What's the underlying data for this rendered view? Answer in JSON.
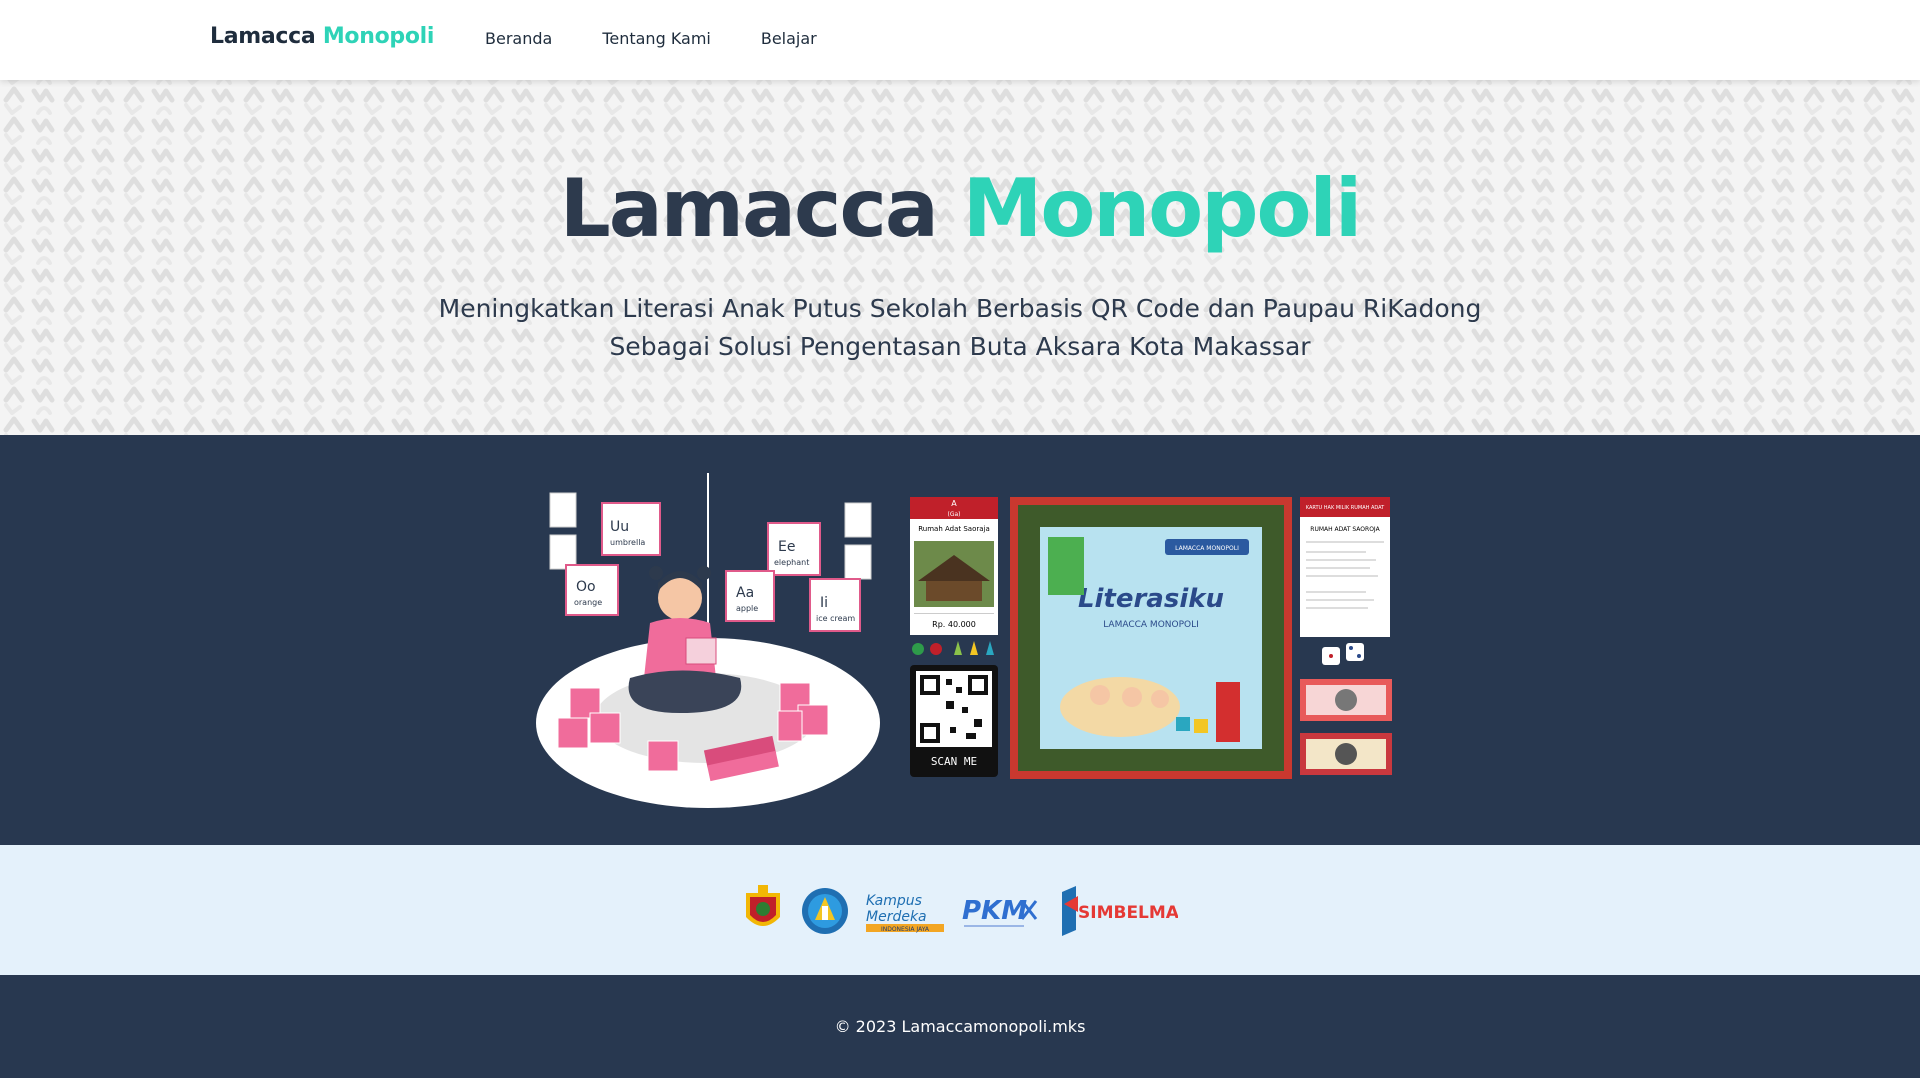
{
  "nav": {
    "brand_main": "Lamacca",
    "brand_accent": "Monopoli",
    "links": [
      "Beranda",
      "Tentang Kami",
      "Belajar"
    ]
  },
  "hero": {
    "title_main": "Lamacca",
    "title_accent": "Monopoli",
    "subtitle_line1": "Meningkatkan Literasi Anak Putus Sekolah Berbasis QR Code dan Paupau RiKadong",
    "subtitle_line2": "Sebagai Solusi Pengentasan Buta Aksara Kota Makassar"
  },
  "showcase": {
    "card_top": "A",
    "card_sub": "(Ga)",
    "card_title": "Rumah Adat Saoraja",
    "card_price": "Rp. 40.000",
    "qr_label": "SCAN ME",
    "board_banner": "LAMACCA MONOPOLI",
    "board_title": "Literasiku",
    "board_subtitle": "LAMACCA MONOPOLI",
    "deed_title": "KARTU HAK MILIK RUMAH ADAT",
    "deed_name": "RUMAH ADAT SAOROJA",
    "letters": [
      "Uu",
      "umbrella",
      "Oo",
      "orange",
      "Ee",
      "elephant",
      "Aa",
      "apple",
      "Ii",
      "ice cream"
    ]
  },
  "partners": {
    "logos": [
      "unhas-logo",
      "tut-wuri-logo",
      "kampus-merdeka-logo",
      "pkm-logo",
      "simbelmawa-logo"
    ],
    "kampus_merdeka_line1": "Kampus",
    "kampus_merdeka_line2": "Merdeka",
    "kampus_merdeka_tag": "INDONESIA JAYA",
    "pkm": "PKM",
    "simbelmawa": "SIMBELMAWA"
  },
  "footer": {
    "copyright": "© 2023 Lamaccamonopoli.mks"
  },
  "colors": {
    "accent": "#2ed3b7",
    "navy": "#283850",
    "text": "#2d3a4d",
    "partners_bg": "#e4f1fb"
  }
}
